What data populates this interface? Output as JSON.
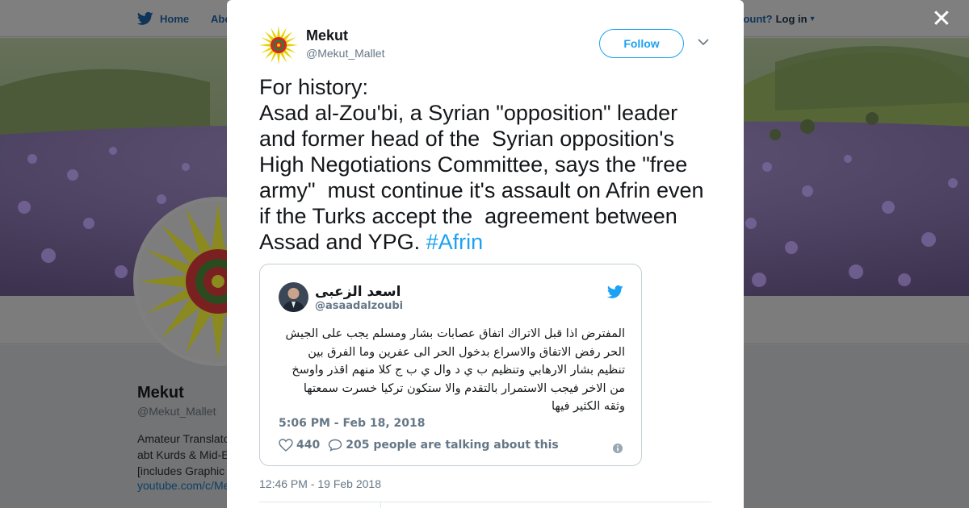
{
  "background_page": {
    "nav": {
      "home_label": "Home",
      "about_label_visible": "Abo",
      "account_prompt_visible": "ccount?",
      "login_label": "Log in"
    },
    "profile": {
      "name": "Mekut",
      "handle": "@Mekut_Mallet",
      "bio_lines_visible": [
        "Amateur Translato",
        "abt Kurds & Mid-E",
        "[includes Graphic"
      ],
      "link_visible": "youtube.com/c/Me"
    }
  },
  "tweet": {
    "author_name": "Mekut",
    "author_handle": "@Mekut_Mallet",
    "follow_label": "Follow",
    "text": "For history:\nAsad al-Zou'bi, a Syrian \"opposition\" leader and former head of the  Syrian opposition's High Negotiations Committee, says the \"free army\"  must continue it's assault on Afrin even if the Turks accept the  agreement between Assad and YPG. ",
    "hashtag": "#Afrin",
    "timestamp": "12:46 PM - 19 Feb 2018",
    "embedded_tweet": {
      "author_name": "اسعد الزعبى",
      "author_handle": "@asaadalzoubi",
      "text": "المفترض اذا قبل الاتراك اتفاق عصابات بشار ومسلم يجب على الجيش الحر رفض الاتفاق والاسراع بدخول الحر الى عفرين وما الفرق بين تنظيم بشار الارهابي وتنظيم ب ي د وال ي ب ج كلا منهم اقذر واوسخ من الاخر فيجب الاستمرار بالتقدم والا ستكون تركيا خسرت سمعتها وثقه الكثير فيها",
      "timestamp": "5:06 PM - Feb 18, 2018",
      "likes": "440",
      "talking": "205 people are talking about this"
    }
  },
  "icons": {
    "close": "close-icon",
    "bird": "twitter-bird-icon",
    "chevron": "chevron-down-icon",
    "heart": "heart-icon",
    "comment": "comment-icon",
    "info": "info-icon"
  },
  "colors": {
    "twitter_blue": "#1da1f2",
    "text_primary": "#14171a",
    "text_secondary": "#657786",
    "overlay_gray": "#7d7d7d"
  }
}
